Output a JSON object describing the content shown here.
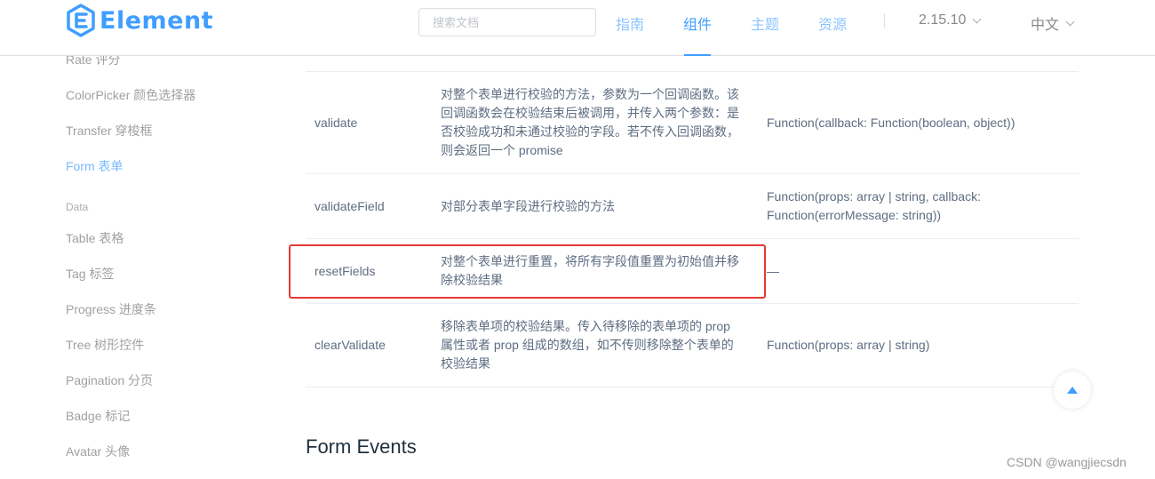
{
  "header": {
    "logo_text": "Element",
    "search_placeholder": "搜索文档",
    "nav": [
      {
        "label": "指南",
        "active": false
      },
      {
        "label": "组件",
        "active": true
      },
      {
        "label": "主题",
        "active": false
      },
      {
        "label": "资源",
        "active": false
      }
    ],
    "version": "2.15.10",
    "language": "中文"
  },
  "sidebar": {
    "items_top": [
      "Rate 评分",
      "ColorPicker 颜色选择器",
      "Transfer 穿梭框",
      "Form 表单"
    ],
    "group_label": "Data",
    "items_data": [
      "Table 表格",
      "Tag 标签",
      "Progress 进度条",
      "Tree 树形控件",
      "Pagination 分页",
      "Badge 标记",
      "Avatar 头像"
    ]
  },
  "methods_table": {
    "rows": [
      {
        "name": "validate",
        "desc_lines": [
          "对整个表单进行校验的方法，参数为一个回调函数。该",
          "回调函数会在校验结束后被调用，并传入两个参数：是",
          "否校验成功和未通过校验的字段。若不传入回调函数，",
          "则会返回一个 promise"
        ],
        "param_lines": [
          "Function(callback: Function(boolean, object))"
        ]
      },
      {
        "name": "validateField",
        "desc_lines": [
          "对部分表单字段进行校验的方法"
        ],
        "param_lines": [
          "Function(props: array | string, callback:",
          "Function(errorMessage: string))"
        ]
      },
      {
        "name": "resetFields",
        "desc_lines": [
          "对整个表单进行重置，将所有字段值重置为初始值并移",
          "除校验结果"
        ],
        "param_lines": [
          "—"
        ]
      },
      {
        "name": "clearValidate",
        "desc_lines": [
          "移除表单项的校验结果。传入待移除的表单项的 prop",
          "属性或者 prop 组成的数组，如不传则移除整个表单的",
          "校验结果"
        ],
        "param_lines": [
          "Function(props: array | string)"
        ]
      }
    ]
  },
  "events_heading": "Form Events",
  "watermark": "CSDN @wangjiecsdn",
  "colors": {
    "accent": "#409eff",
    "highlight_border": "#e53935"
  }
}
